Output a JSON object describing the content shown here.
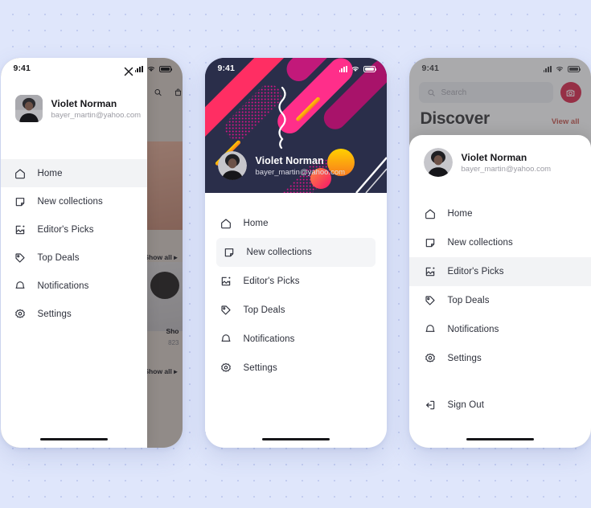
{
  "user": {
    "name": "Violet Norman",
    "email": "bayer_martin@yahoo.com"
  },
  "status_bar": {
    "time": "9:41",
    "signal_icon": "cellular-bars-icon",
    "wifi_icon": "wifi-icon",
    "battery_icon": "battery-full-icon"
  },
  "menu_labels": {
    "home": "Home",
    "new_collections": "New collections",
    "editors_picks": "Editor's Picks",
    "top_deals": "Top Deals",
    "notifications": "Notifications",
    "settings": "Settings",
    "sign_out": "Sign Out"
  },
  "phone1": {
    "active_item": "Home",
    "close_label": "close-icon",
    "search_label": "search-icon",
    "bag_label": "shopping-bag-icon",
    "background": {
      "show_all_1": "Show all ▸",
      "show_all_2": "Show all ▸",
      "product_name": "Sho",
      "product_price": "823 "
    },
    "menu": [
      {
        "label": "Home",
        "icon": "home-icon",
        "active": true
      },
      {
        "label": "New collections",
        "icon": "note-icon",
        "active": false
      },
      {
        "label": "Editor's Picks",
        "icon": "image-icon",
        "active": false
      },
      {
        "label": "Top Deals",
        "icon": "tag-icon",
        "active": false
      },
      {
        "label": "Notifications",
        "icon": "bell-icon",
        "active": false
      },
      {
        "label": "Settings",
        "icon": "gear-icon",
        "active": false
      }
    ]
  },
  "phone2": {
    "active_item": "New collections",
    "header_bg_color": "#2a2e4a",
    "accent_pink": "#ff3366",
    "accent_magenta": "#c2197a",
    "accent_yellow": "#ffc400",
    "menu": [
      {
        "label": "Home",
        "icon": "home-icon",
        "active": false
      },
      {
        "label": "New collections",
        "icon": "note-icon",
        "active": true
      },
      {
        "label": "Editor's Picks",
        "icon": "image-icon",
        "active": false
      },
      {
        "label": "Top Deals",
        "icon": "tag-icon",
        "active": false
      },
      {
        "label": "Notifications",
        "icon": "bell-icon",
        "active": false
      },
      {
        "label": "Settings",
        "icon": "gear-icon",
        "active": false
      }
    ]
  },
  "phone3": {
    "active_item": "Editor's Picks",
    "search_placeholder": "Search",
    "camera_icon": "camera-icon",
    "camera_button_color": "#d5002b",
    "page_title": "Discover",
    "view_all": "View all",
    "view_all_color": "#c0392f",
    "menu": [
      {
        "label": "Home",
        "icon": "home-icon",
        "active": false
      },
      {
        "label": "New collections",
        "icon": "note-icon",
        "active": false
      },
      {
        "label": "Editor's Picks",
        "icon": "image-icon",
        "active": true
      },
      {
        "label": "Top Deals",
        "icon": "tag-icon",
        "active": false
      },
      {
        "label": "Notifications",
        "icon": "bell-icon",
        "active": false
      },
      {
        "label": "Settings",
        "icon": "gear-icon",
        "active": false
      }
    ],
    "sign_out": {
      "label": "Sign Out",
      "icon": "sign-out-icon"
    }
  }
}
